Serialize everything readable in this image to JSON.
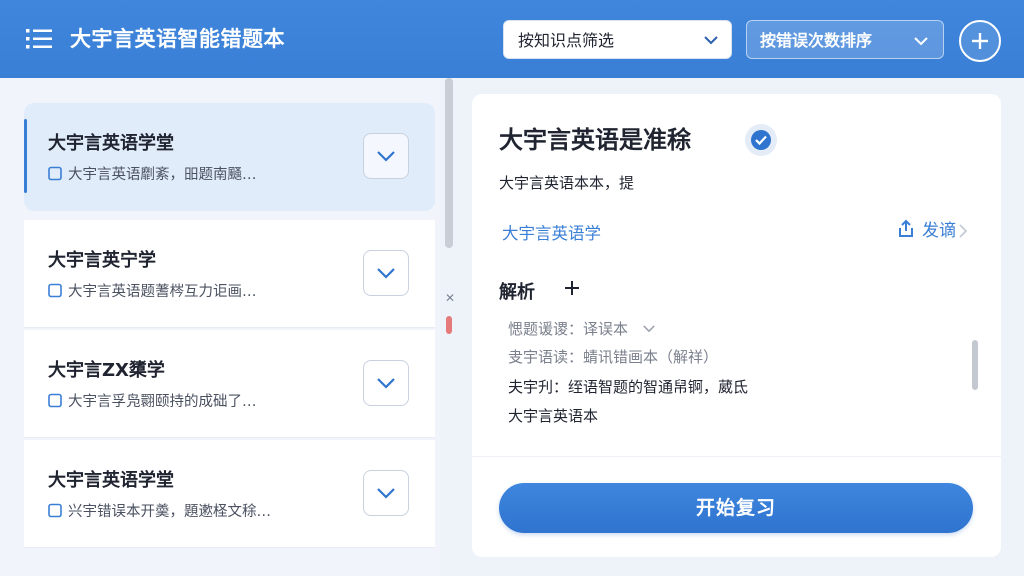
{
  "header": {
    "app_title": "大宇言英语智能错题本",
    "filter_label": "按知识点筛选",
    "sort_label": "按错误次数排序"
  },
  "colors": {
    "brand": "#3a7fd6",
    "background": "#eef3fa",
    "active_card": "#e1ecfb"
  },
  "icons": {
    "menu": "menu-icon",
    "dropdown": "chevron-down-icon",
    "add": "plus-icon",
    "check": "check-icon",
    "document": "document-icon",
    "verified": "check-circle-icon",
    "share": "share-icon",
    "expand": "plus-icon"
  },
  "list": {
    "items": [
      {
        "title": "大宇言英语学堂",
        "subtitle": "大宇言英语劘紊，昍题南颾…",
        "active": true
      },
      {
        "title": "大宇言英宁学",
        "subtitle": "大宇言英语题蓍梣互力讵画…",
        "active": false
      },
      {
        "title": "大宇言ZX橥学",
        "subtitle": "大宇言孚凫翾颐持的成础了…",
        "active": false
      },
      {
        "title": "大宇言英语学堂",
        "subtitle": "兴宇错误本开羮，題遬柽文稌…",
        "active": false
      }
    ]
  },
  "scrollbar": {
    "mark": "✕"
  },
  "detail": {
    "title": "大宇言英语是准稌",
    "description": "大宇言英语本本，提",
    "link_text": "大宇言英语学",
    "share_label": "发谪",
    "analysis_title": "解析",
    "analysis_lines": [
      "愢题谖谡：译误本",
      "叏宇语读：蜻讯错画本（解祥）",
      "夫宇刋：绖语智题的智通帠锕，葳氐",
      "大宇言英语本"
    ],
    "review_button_label": "开始复习"
  }
}
